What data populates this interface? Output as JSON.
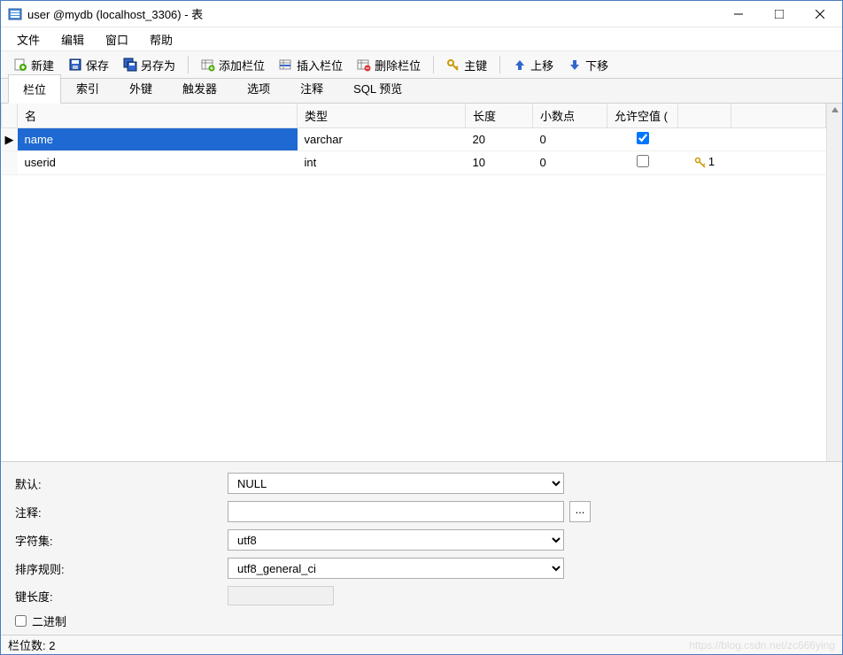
{
  "window": {
    "title": "user @mydb (localhost_3306) - 表"
  },
  "menu": {
    "file": "文件",
    "edit": "编辑",
    "window": "窗口",
    "help": "帮助"
  },
  "toolbar": {
    "new": "新建",
    "save": "保存",
    "save_as": "另存为",
    "add_field": "添加栏位",
    "insert_field": "插入栏位",
    "delete_field": "删除栏位",
    "primary_key": "主键",
    "move_up": "上移",
    "move_down": "下移"
  },
  "tabs": {
    "fields": "栏位",
    "indexes": "索引",
    "foreign_keys": "外键",
    "triggers": "触发器",
    "options": "选项",
    "comment": "注释",
    "sql_preview": "SQL 预览"
  },
  "grid": {
    "headers": {
      "name": "名",
      "type": "类型",
      "length": "长度",
      "decimals": "小数点",
      "not_null": "允许空值 (",
      "key": ""
    },
    "rows": [
      {
        "name": "name",
        "type": "varchar",
        "length": "20",
        "decimals": "0",
        "allow_null": true,
        "key": "",
        "selected": true
      },
      {
        "name": "userid",
        "type": "int",
        "length": "10",
        "decimals": "0",
        "allow_null": false,
        "key": "1",
        "selected": false
      }
    ]
  },
  "props": {
    "default_label": "默认:",
    "default_value": "NULL",
    "comment_label": "注释:",
    "comment_value": "",
    "charset_label": "字符集:",
    "charset_value": "utf8",
    "collation_label": "排序规则:",
    "collation_value": "utf8_general_ci",
    "key_length_label": "键长度:",
    "binary_label": "二进制"
  },
  "statusbar": {
    "field_count": "栏位数: 2"
  },
  "watermark": "https://blog.csdn.net/zc666ying"
}
